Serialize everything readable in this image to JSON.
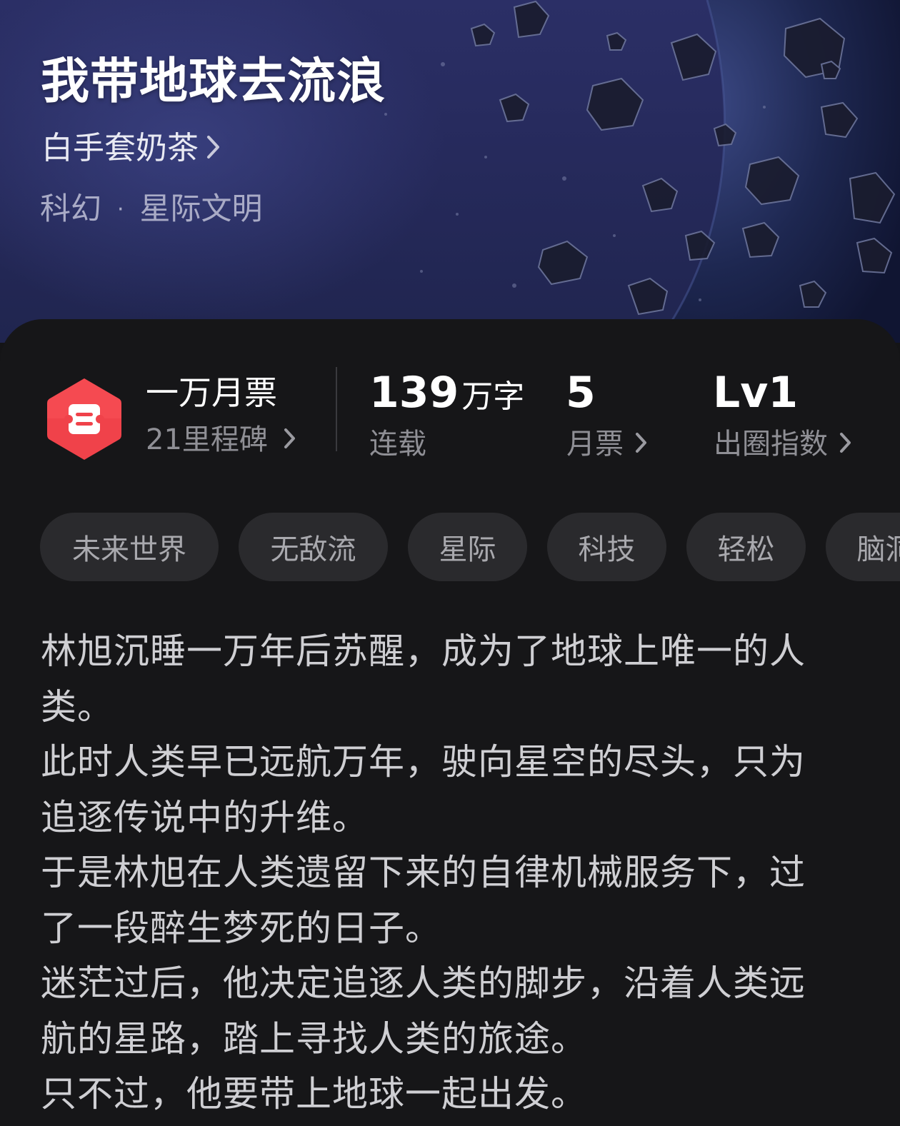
{
  "book": {
    "title": "我带地球去流浪",
    "author": "白手套奶茶",
    "genre": "科幻",
    "genre_separator": "·",
    "subgenre": "星际文明"
  },
  "stats": {
    "monthly_ticket_title": "一万月票",
    "milestone": "21里程碑",
    "word_count": "139",
    "word_count_unit": "万字",
    "status": "连载",
    "tickets": "5",
    "tickets_label": "月票",
    "level": "Lv1",
    "level_label": "出圈指数"
  },
  "tags": [
    "未来世界",
    "无敌流",
    "星际",
    "科技",
    "轻松",
    "脑洞"
  ],
  "synopsis": [
    "林旭沉睡一万年后苏醒，成为了地球上唯一的人类。",
    "此时人类早已远航万年，驶向星空的尽头，只为追逐传说中的升维。",
    "于是林旭在人类遗留下来的自律机械服务下，过了一段醉生梦死的日子。",
    "迷茫过后，他决定追逐人类的脚步，沿着人类远航的星路，踏上寻找人类的旅途。",
    "只不过，他要带上地球一起出发。"
  ],
  "colors": {
    "badge": "#f0424a",
    "sheet": "#161618",
    "tag_bg": "#2a2a2d",
    "hero": "#262a5c"
  },
  "icons": [
    "chevron-right-icon",
    "ticket-badge-icon"
  ]
}
